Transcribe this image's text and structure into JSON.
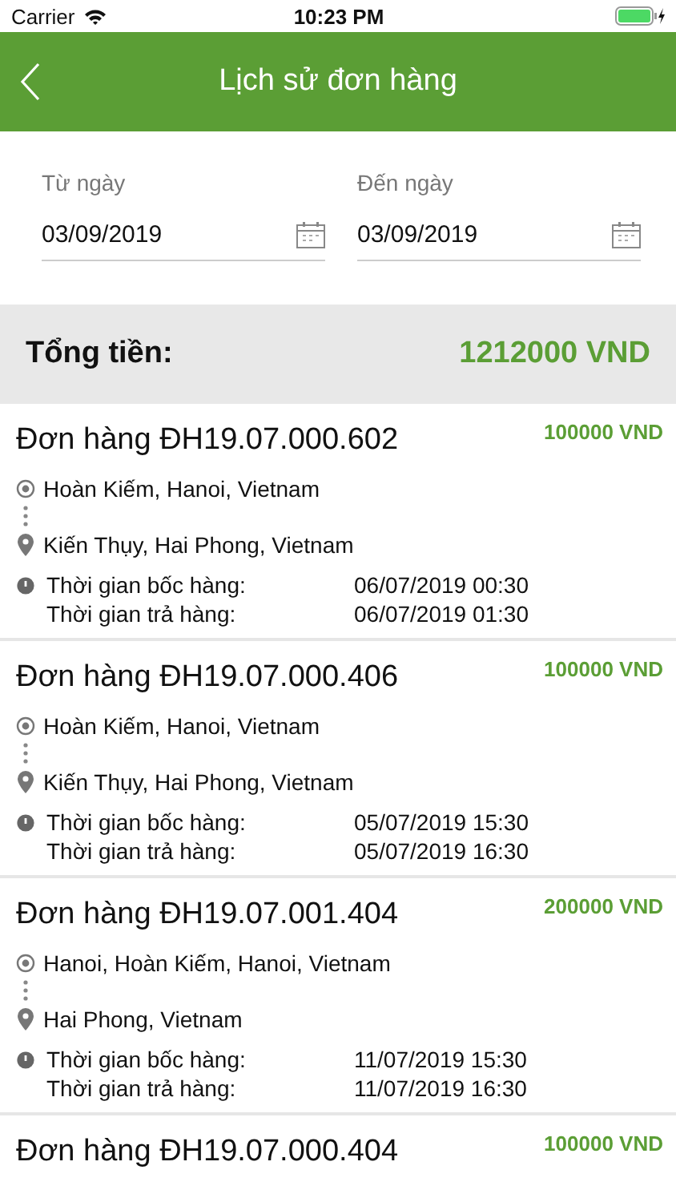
{
  "status_bar": {
    "carrier": "Carrier",
    "time": "10:23 PM"
  },
  "header": {
    "title": "Lịch sử đơn hàng"
  },
  "date_filter": [
    {
      "label": "Từ ngày",
      "value": "03/09/2019"
    },
    {
      "label": "Đến ngày",
      "value": "03/09/2019"
    }
  ],
  "total": {
    "label": "Tổng tiền:",
    "amount": "1212000 VND"
  },
  "orders": [
    {
      "title": "Đơn hàng ĐH19.07.000.602",
      "price": "100000 VND",
      "origin": "Hoàn Kiếm, Hanoi, Vietnam",
      "destination": "Kiến Thụy, Hai Phong, Vietnam",
      "times": [
        {
          "label": "Thời gian bốc hàng:",
          "value": "06/07/2019 00:30"
        },
        {
          "label": "Thời gian trả hàng:",
          "value": "06/07/2019 01:30"
        }
      ]
    },
    {
      "title": "Đơn hàng ĐH19.07.000.406",
      "price": "100000 VND",
      "origin": "Hoàn Kiếm, Hanoi, Vietnam",
      "destination": "Kiến Thụy, Hai Phong, Vietnam",
      "times": [
        {
          "label": "Thời gian bốc hàng:",
          "value": "05/07/2019 15:30"
        },
        {
          "label": "Thời gian trả hàng:",
          "value": "05/07/2019 16:30"
        }
      ]
    },
    {
      "title": "Đơn hàng ĐH19.07.001.404",
      "price": "200000 VND",
      "origin": "Hanoi, Hoàn Kiếm, Hanoi, Vietnam",
      "destination": "Hai Phong, Vietnam",
      "times": [
        {
          "label": "Thời gian bốc hàng:",
          "value": "11/07/2019 15:30"
        },
        {
          "label": "Thời gian trả hàng:",
          "value": "11/07/2019 16:30"
        }
      ]
    },
    {
      "title": "Đơn hàng ĐH19.07.000.404",
      "price": "100000 VND"
    }
  ]
}
